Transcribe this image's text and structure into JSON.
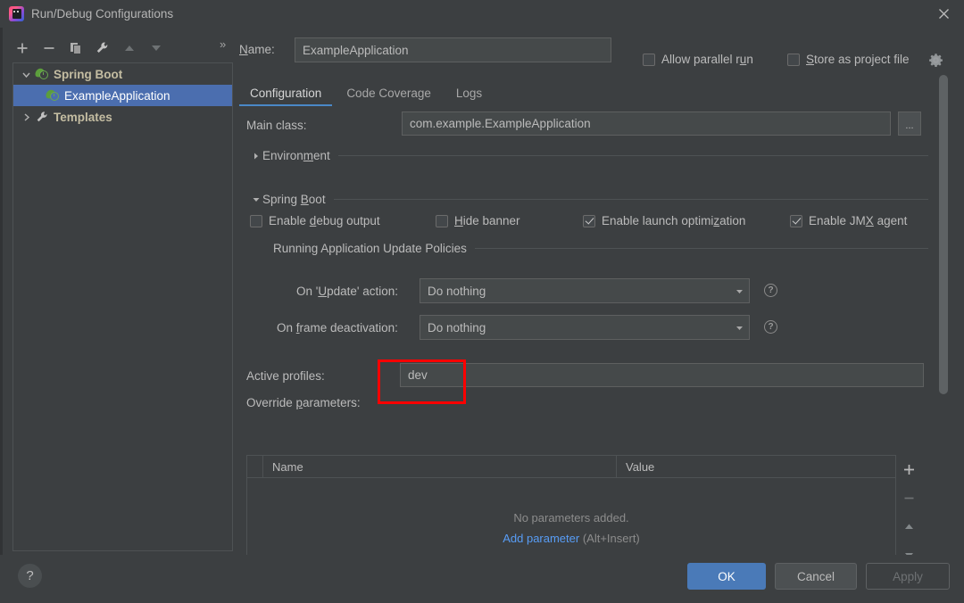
{
  "window": {
    "title": "Run/Debug Configurations",
    "app_icon": "intellij-idea-icon",
    "close_icon": "close-icon"
  },
  "left_panel": {
    "toolbar": [
      {
        "name": "add-configuration-button",
        "icon": "plus-icon"
      },
      {
        "name": "remove-configuration-button",
        "icon": "minus-icon"
      },
      {
        "name": "copy-configuration-button",
        "icon": "copy-icon"
      },
      {
        "name": "edit-templates-button",
        "icon": "wrench-icon"
      },
      {
        "name": "move-up-button",
        "icon": "arrow-up-icon"
      },
      {
        "name": "move-down-button",
        "icon": "arrow-down-icon"
      }
    ],
    "overflow_label": "»",
    "tree": [
      {
        "label": "Spring Boot",
        "icon": "spring-boot-icon",
        "twisty": "chevron-down-icon",
        "level": 0,
        "selected": false,
        "bold": true
      },
      {
        "label": "ExampleApplication",
        "icon": "spring-boot-icon",
        "twisty": "",
        "level": 1,
        "selected": true,
        "bold": false
      },
      {
        "label": "Templates",
        "icon": "wrench-icon",
        "twisty": "chevron-right-icon",
        "level": 0,
        "selected": false,
        "bold": true
      }
    ]
  },
  "header": {
    "name_label_pre": "N",
    "name_label_mnemonic": "",
    "name_label": "Name:",
    "name_value": "ExampleApplication",
    "allow_parallel_run": {
      "label_a": "Allow parallel r",
      "mnemonic": "u",
      "label_b": "n",
      "checked": false
    },
    "store_as_project_file": {
      "mnemonic": "S",
      "label_b": "tore as project file",
      "checked": false
    },
    "gear_icon": "gear-icon"
  },
  "tabs": [
    {
      "label": "Configuration",
      "active": true
    },
    {
      "label": "Code Coverage",
      "active": false
    },
    {
      "label": "Logs",
      "active": false
    }
  ],
  "form": {
    "main_class": {
      "label": "Main class:",
      "value": "com.example.ExampleApplication",
      "browse_label": "..."
    },
    "environment": {
      "label_a": "Environ",
      "mnemonic": "m",
      "label_b": "ent",
      "expanded": false,
      "twisty_icon": "chevron-right-icon"
    },
    "spring_boot": {
      "label_a": "Spring ",
      "mnemonic": "B",
      "label_b": "oot",
      "expanded": true,
      "twisty_icon": "chevron-down-icon"
    },
    "checkboxes": [
      {
        "label_a": "Enable ",
        "mnemonic": "d",
        "label_b": "ebug output",
        "checked": false,
        "name": "enable-debug-output"
      },
      {
        "label_a": "",
        "mnemonic": "H",
        "label_b": "ide banner",
        "checked": false,
        "name": "hide-banner"
      },
      {
        "label_a": "Enable launch optimi",
        "mnemonic": "z",
        "label_b": "ation",
        "checked": true,
        "name": "enable-launch-optimization"
      },
      {
        "label_a": "Enable JM",
        "mnemonic": "X",
        "label_b": " agent",
        "checked": true,
        "name": "enable-jmx-agent"
      }
    ],
    "update_policies_title": "Running Application Update Policies",
    "on_update_action": {
      "label_a": "On '",
      "mnemonic": "U",
      "label_b": "pdate' action:",
      "value": "Do nothing",
      "help_icon": "question-mark-icon"
    },
    "on_frame_deactivation": {
      "label_a": "On ",
      "mnemonic": "f",
      "label_b": "rame deactivation:",
      "value": "Do nothing",
      "help_icon": "question-mark-icon"
    },
    "active_profiles": {
      "label": "Active profiles:",
      "value": "dev"
    },
    "override_parameters": {
      "label_a": "Override ",
      "mnemonic": "p",
      "label_b": "arameters:"
    },
    "params_table": {
      "columns": [
        "Name",
        "Value"
      ],
      "rows": [],
      "empty_text": "No parameters added.",
      "action_link": "Add parameter",
      "action_hint": " (Alt+Insert)",
      "sidebar": [
        {
          "name": "add-parameter-button",
          "icon": "plus-icon"
        },
        {
          "name": "remove-parameter-button",
          "icon": "minus-icon"
        },
        {
          "name": "move-parameter-up-button",
          "icon": "arrow-up-icon"
        },
        {
          "name": "move-parameter-down-button",
          "icon": "arrow-down-icon"
        }
      ]
    }
  },
  "annotation": {
    "color": "#ff0000",
    "target": "active-profiles-input"
  },
  "footer": {
    "help_label": "?",
    "ok_label": "OK",
    "cancel_label": "Cancel",
    "apply_label": "Apply",
    "apply_enabled": false
  },
  "colors": {
    "window_bg": "#3c3f41",
    "field_bg": "#45494a",
    "border": "#5e6060",
    "selection_blue": "#4b6eaf",
    "accent_blue": "#4a88c7",
    "link_blue": "#589df6",
    "ok_button": "#4a7ab8",
    "annotation_red": "#ff0000",
    "text": "#bbbbbb",
    "muted_text": "#8c8c8c",
    "bold_tree_text": "#c4bda2"
  }
}
